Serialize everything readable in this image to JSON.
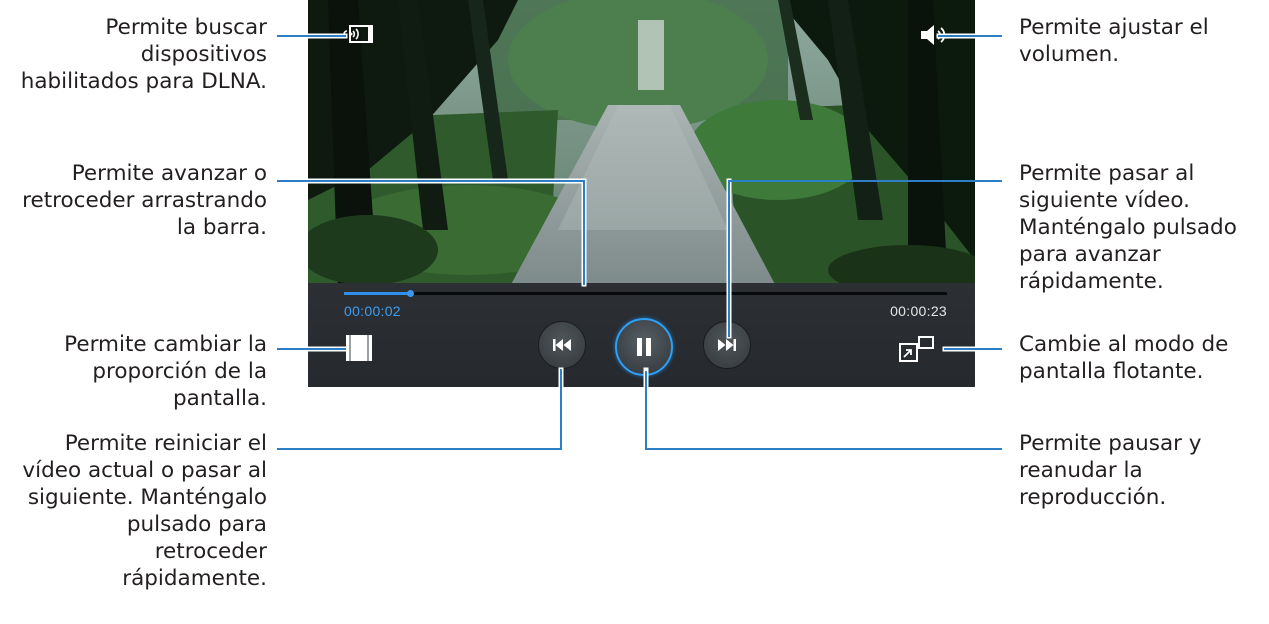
{
  "player": {
    "time_elapsed": "00:00:02",
    "time_total": "00:00:23",
    "progress_fraction": 0.11,
    "accent_color": "#2f8ee8",
    "icons": {
      "dlna": "dlna-device-search-icon",
      "volume": "speaker-volume-icon",
      "ratio": "screen-ratio-icon",
      "prev": "skip-previous-icon",
      "pause": "pause-icon",
      "next": "skip-next-icon",
      "popup": "popup-play-icon"
    }
  },
  "callouts": {
    "dlna": [
      "Permite buscar",
      "dispositivos",
      "habilitados para DLNA."
    ],
    "seek": [
      "Permite avanzar o",
      "retroceder arrastrando",
      "la barra."
    ],
    "ratio": [
      "Permite cambiar la",
      "proporción de la",
      "pantalla."
    ],
    "prev": [
      "Permite reiniciar el",
      "vídeo actual o pasar al",
      "siguiente. Manténgalo",
      "pulsado para",
      "retroceder",
      "rápidamente."
    ],
    "volume": [
      "Permite ajustar el",
      "volumen."
    ],
    "next": [
      "Permite pasar al",
      "siguiente vídeo.",
      "Manténgalo pulsado",
      "para avanzar",
      "rápidamente."
    ],
    "popup": [
      "Cambie al modo de",
      "pantalla flotante."
    ],
    "pause": [
      "Permite pausar y",
      "reanudar la",
      "reproducción."
    ]
  }
}
